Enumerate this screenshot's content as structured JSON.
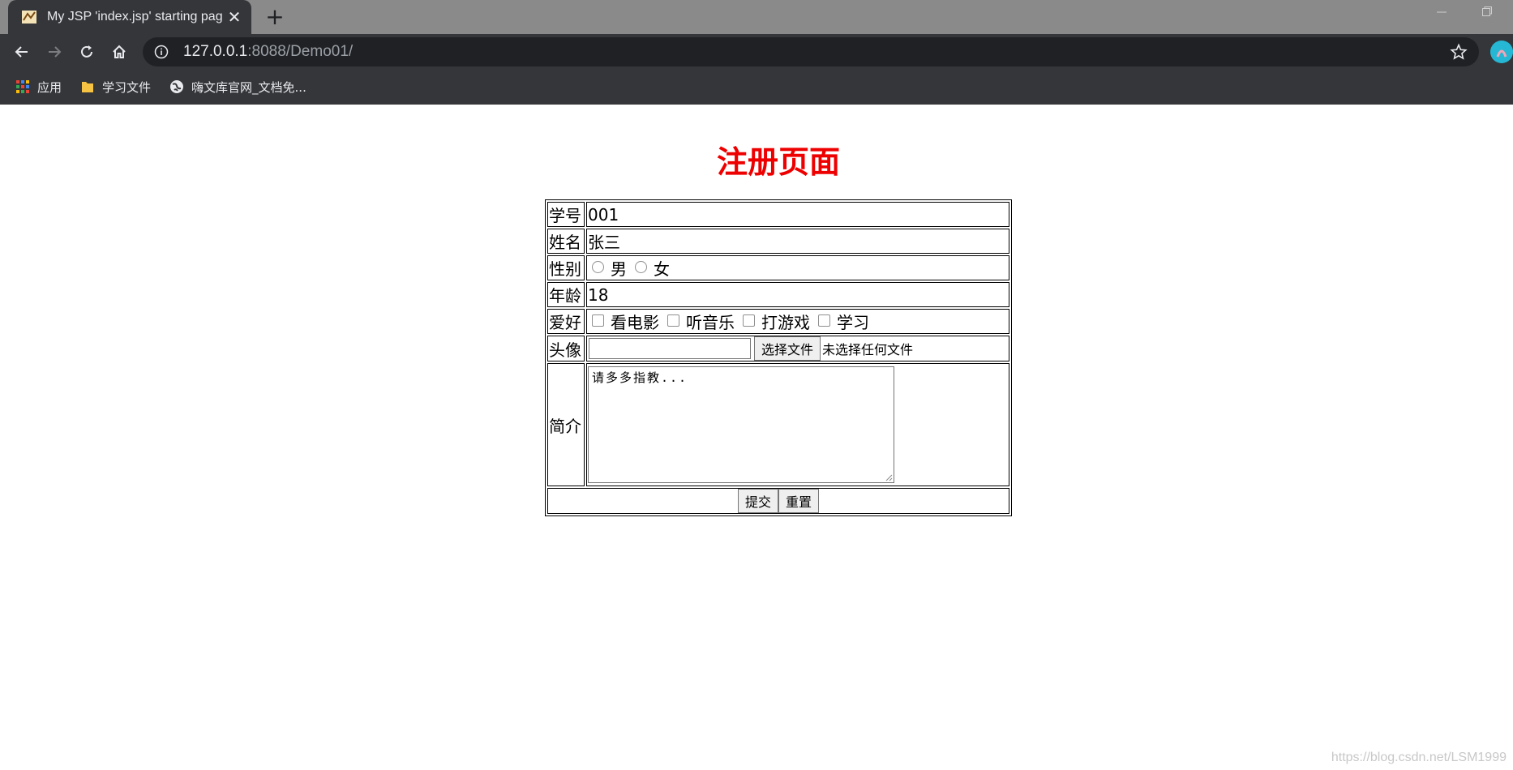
{
  "browser": {
    "tab_title": "My JSP 'index.jsp' starting pag",
    "tab_close": "✕",
    "new_tab": "+",
    "url_host": "127.0.0.1",
    "url_rest": ":8088/Demo01/",
    "bookmarks": [
      "应用",
      "学习文件",
      "嗨文库官网_文档免..."
    ]
  },
  "page": {
    "title": "注册页面",
    "fields": {
      "id_label": "学号",
      "id_value": "001",
      "name_label": "姓名",
      "name_value": "张三",
      "gender_label": "性别",
      "gender_options": [
        "男",
        "女"
      ],
      "age_label": "年龄",
      "age_value": "18",
      "hobby_label": "爱好",
      "hobby_options": [
        "看电影",
        "听音乐",
        "打游戏",
        "学习"
      ],
      "avatar_label": "头像",
      "file_button": "选择文件",
      "file_status": "未选择任何文件",
      "intro_label": "简介",
      "intro_value": "请多多指教..."
    },
    "submit_label": "提交",
    "reset_label": "重置"
  },
  "watermark": "https://blog.csdn.net/LSM1999"
}
